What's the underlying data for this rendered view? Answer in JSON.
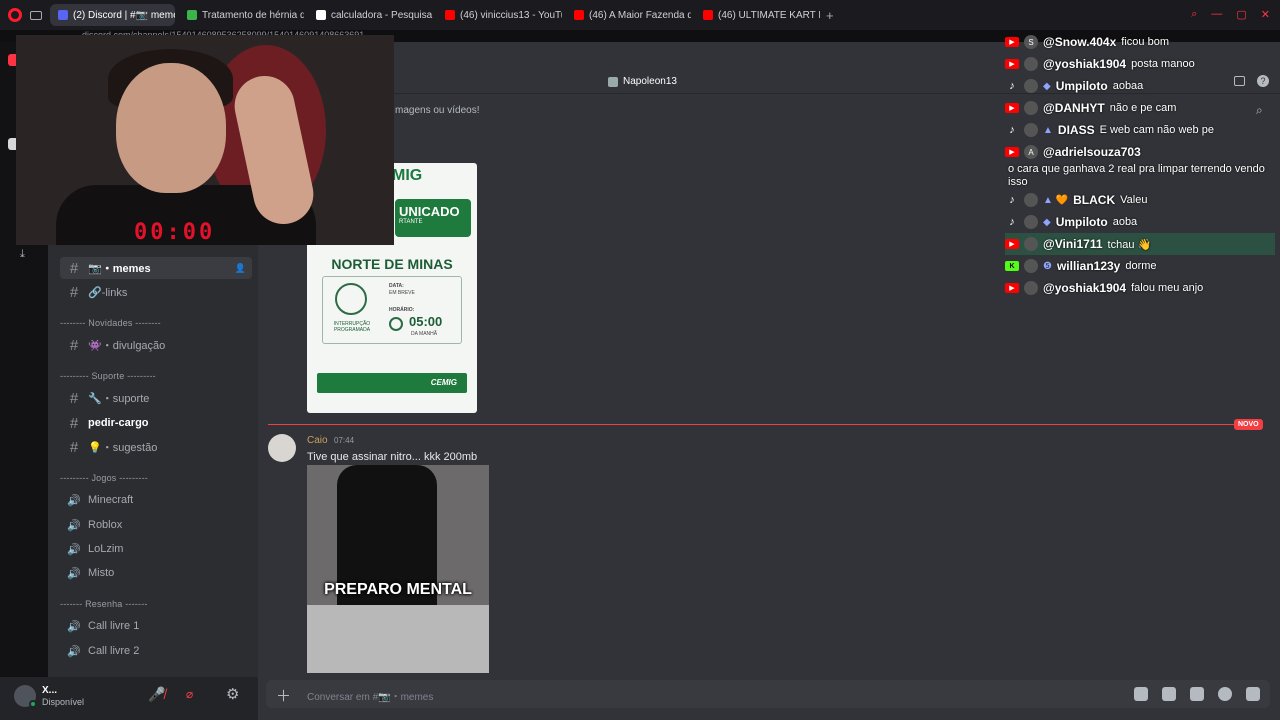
{
  "browser": {
    "tabs": [
      {
        "label": "(2) Discord | #📷 memes",
        "color": "#5865f2",
        "active": true
      },
      {
        "label": "Tratamento de hérnia de d",
        "color": "#3bb54a"
      },
      {
        "label": "calculadora - Pesquisa Go",
        "color": "#ffffff"
      },
      {
        "label": "(46) viniccius13 - YouTube",
        "color": "#ff0000"
      },
      {
        "label": "(46) A Maior Fazenda de T",
        "color": "#ff0000"
      },
      {
        "label": "(46) ULTIMATE KART RACE",
        "color": "#ff0000"
      }
    ],
    "new_tab": "+",
    "url": "discord.com/channels/1540146089536258099/1540146091408663691"
  },
  "voice": {
    "name": "Napoleon13"
  },
  "upload_hint": "magens ou vídeos!",
  "sidebar": {
    "channels": [
      {
        "name": "📷・memes",
        "type": "text",
        "selected": true
      },
      {
        "name": "🔗-links",
        "type": "text"
      },
      {
        "category": "-------- Novidades --------"
      },
      {
        "name": "👾・divulgação",
        "type": "text"
      },
      {
        "category": "--------- Suporte ---------"
      },
      {
        "name": "🔧・suporte",
        "type": "text"
      },
      {
        "name": "pedir-cargo",
        "type": "text",
        "unread": true
      },
      {
        "name": "💡・sugestão",
        "type": "text"
      },
      {
        "category": "--------- Jogos ---------"
      },
      {
        "name": "Minecraft",
        "type": "voice"
      },
      {
        "name": "Roblox",
        "type": "voice"
      },
      {
        "name": "LoLzim",
        "type": "voice"
      },
      {
        "name": "Misto",
        "type": "voice"
      },
      {
        "category": "------- Resenha -------"
      },
      {
        "name": "Call livre 1",
        "type": "voice"
      },
      {
        "name": "Call livre 2",
        "type": "voice"
      }
    ]
  },
  "user": {
    "name": "X...",
    "status": "Disponível"
  },
  "poster": {
    "brand": "MIG",
    "headline": "UNICADO",
    "sub": "RTANTE",
    "region": "NORTE DE MINAS",
    "date_label": "DATA:",
    "date_value": "EM BREVE",
    "time_label": "HORÁRIO:",
    "time_value": "05:00",
    "time_sub": "DA MANHÃ",
    "interruption": "INTERRUPÇÃO PROGRAMADA",
    "footer_brand": "CEMIG"
  },
  "new_badge": "NOVO",
  "message": {
    "author": "Caio",
    "time": "07:44",
    "text": "Tive que assinar nitro... kkk 200mb",
    "video_caption": "PREPARO MENTAL"
  },
  "composer": {
    "placeholder": "Conversar em #📷・memes"
  },
  "stream": {
    "timer": "00:00"
  },
  "chat": [
    {
      "platform": "yt",
      "avatar": "S",
      "user": "@Snow.404x",
      "msg": "ficou bom"
    },
    {
      "platform": "yt",
      "avatar": "",
      "user": "@yoshiak1904",
      "msg": "posta manoo"
    },
    {
      "platform": "tt",
      "avatar": "",
      "badge": "◆",
      "user": "Umpiloto",
      "msg": "aobaa"
    },
    {
      "platform": "yt",
      "avatar": "",
      "user": "@DANHYT",
      "msg": "não e pe cam"
    },
    {
      "platform": "tt",
      "avatar": "",
      "badge": "▲",
      "user": "DIASS",
      "msg": "E web cam não web pe"
    },
    {
      "platform": "yt",
      "avatar": "A",
      "user": "@adrielsouza703",
      "msg": ""
    },
    {
      "wrap": "o cara que ganhava 2 real pra limpar terrendo vendo isso"
    },
    {
      "platform": "tt",
      "avatar": "",
      "badge": "▲ 🧡",
      "user": "BLACK",
      "msg": "Valeu"
    },
    {
      "platform": "tt",
      "avatar": "",
      "badge": "◆",
      "user": "Umpiloto",
      "msg": "aoba"
    },
    {
      "platform": "yt",
      "avatar": "",
      "user": "@Vini1711",
      "msg": "tchau 👋",
      "highlight": true
    },
    {
      "platform": "kk",
      "avatar": "",
      "badge": "❺",
      "user": "willian123y",
      "msg": "dorme"
    },
    {
      "platform": "yt",
      "avatar": "",
      "user": "@yoshiak1904",
      "msg": "falou meu anjo"
    }
  ]
}
